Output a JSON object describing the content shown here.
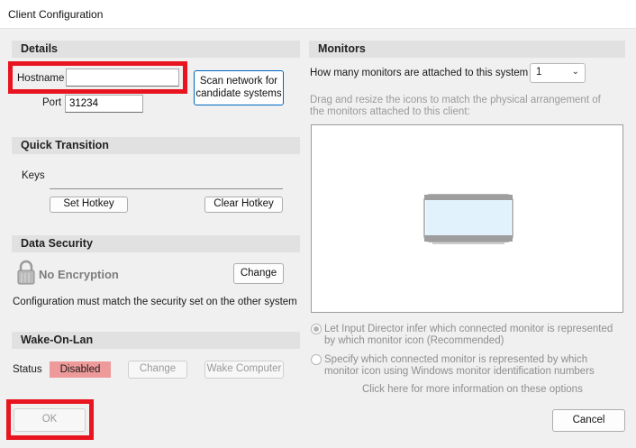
{
  "window": {
    "title": "Client Configuration",
    "close_glyph": "✕"
  },
  "details": {
    "header": "Details",
    "hostname_label": "Hostname",
    "hostname_value": "",
    "port_label": "Port",
    "port_value": "31234",
    "scan_button": "Scan network for candidate systems"
  },
  "quick_transition": {
    "header": "Quick Transition",
    "keys_label": "Keys",
    "set_hotkey": "Set Hotkey",
    "clear_hotkey": "Clear Hotkey"
  },
  "data_security": {
    "header": "Data Security",
    "encryption_status": "No Encryption",
    "change_button": "Change",
    "note": "Configuration must match the security set on the other system"
  },
  "wake_on_lan": {
    "header": "Wake-On-Lan",
    "status_label": "Status",
    "status_value": "Disabled",
    "status_color": "#ef9a9a",
    "change_button": "Change",
    "wake_button": "Wake Computer"
  },
  "monitors": {
    "header": "Monitors",
    "count_label": "How many monitors are attached to this system",
    "count_value": "1",
    "instructions": "Drag and resize the icons to match the physical arrangement of the monitors attached to this client:",
    "option_infer": "Let Input Director infer which connected monitor is represented by which monitor icon (Recommended)",
    "option_specify": "Specify which connected monitor is represented by which monitor icon using Windows monitor identification numbers",
    "info_link": "Click here for more information on these options"
  },
  "footer": {
    "ok_button": "OK",
    "cancel_button": "Cancel"
  },
  "colors": {
    "highlight_box": "#e8141f",
    "accent": "#0067c0"
  },
  "icons": {
    "lock": "lock-icon",
    "monitor": "monitor-icon",
    "close": "close-icon",
    "dropdown": "chevron-down-icon"
  }
}
